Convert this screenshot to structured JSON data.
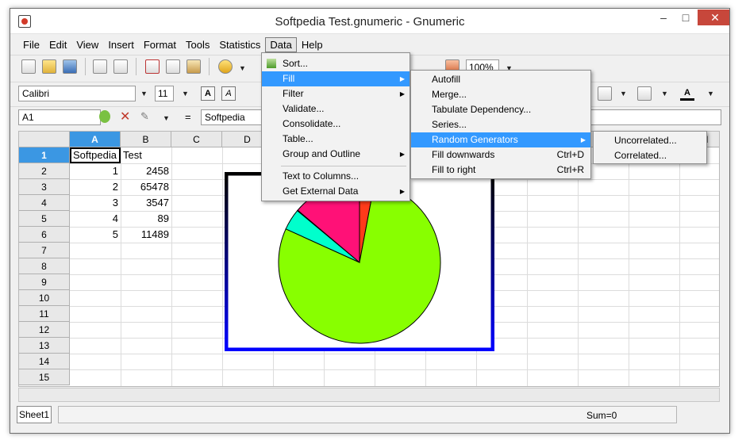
{
  "window": {
    "title": "Softpedia Test.gnumeric - Gnumeric"
  },
  "menubar": [
    {
      "label": "File",
      "key": "F"
    },
    {
      "label": "Edit",
      "key": "E"
    },
    {
      "label": "View",
      "key": "V"
    },
    {
      "label": "Insert",
      "key": "I"
    },
    {
      "label": "Format",
      "key": "o"
    },
    {
      "label": "Tools",
      "key": "T"
    },
    {
      "label": "Statistics",
      "key": "S"
    },
    {
      "label": "Data",
      "key": "D"
    },
    {
      "label": "Help",
      "key": "H"
    }
  ],
  "toolbar": {
    "font_name": "Calibri",
    "font_size": "11",
    "zoom": "100%",
    "bold": "A",
    "italic": "A"
  },
  "formula": {
    "cell_ref": "A1",
    "equals": "=",
    "content": "Softpedia"
  },
  "columns": [
    "A",
    "B",
    "C",
    "D",
    "E",
    "F",
    "G",
    "H",
    "I",
    "J",
    "K",
    "L",
    "M"
  ],
  "rows": [
    "1",
    "2",
    "3",
    "4",
    "5",
    "6",
    "7",
    "8",
    "9",
    "10",
    "11",
    "12",
    "13",
    "14",
    "15"
  ],
  "cells": {
    "a1": "Softpedia",
    "b1": "Test",
    "a2": "1",
    "b2": "2458",
    "a3": "2",
    "b3": "65478",
    "a4": "3",
    "b4": "3547",
    "a5": "4",
    "b5": "89",
    "a6": "5",
    "b6": "11489"
  },
  "data_menu": {
    "items": [
      {
        "label": "Sort...",
        "submenu": false
      },
      {
        "label": "Fill",
        "submenu": true
      },
      {
        "label": "Filter",
        "submenu": true
      },
      {
        "label": "Validate...",
        "submenu": false
      },
      {
        "label": "Consolidate...",
        "submenu": false
      },
      {
        "label": "Table...",
        "submenu": false
      },
      {
        "label": "Group and Outline",
        "submenu": true
      },
      {
        "label": "Text to Columns...",
        "submenu": false
      },
      {
        "label": "Get External Data",
        "submenu": true
      }
    ]
  },
  "fill_menu": {
    "items": [
      {
        "label": "Autofill",
        "accel": ""
      },
      {
        "label": "Merge...",
        "accel": ""
      },
      {
        "label": "Tabulate Dependency...",
        "accel": ""
      },
      {
        "label": "Series...",
        "accel": ""
      },
      {
        "label": "Random Generators",
        "accel": ""
      },
      {
        "label": "Fill downwards",
        "accel": "Ctrl+D"
      },
      {
        "label": "Fill to right",
        "accel": "Ctrl+R"
      }
    ]
  },
  "random_menu": {
    "items": [
      {
        "label": "Uncorrelated..."
      },
      {
        "label": "Correlated..."
      }
    ]
  },
  "status": {
    "sheet_tab": "Sheet1",
    "sum": "Sum=0"
  },
  "chart_data": {
    "type": "pie",
    "values": [
      2458,
      65478,
      3547,
      89,
      11489
    ],
    "colors": [
      "#ff3b1a",
      "#88ff00",
      "#00ffcc",
      "#2010ff",
      "#ff1177"
    ]
  }
}
